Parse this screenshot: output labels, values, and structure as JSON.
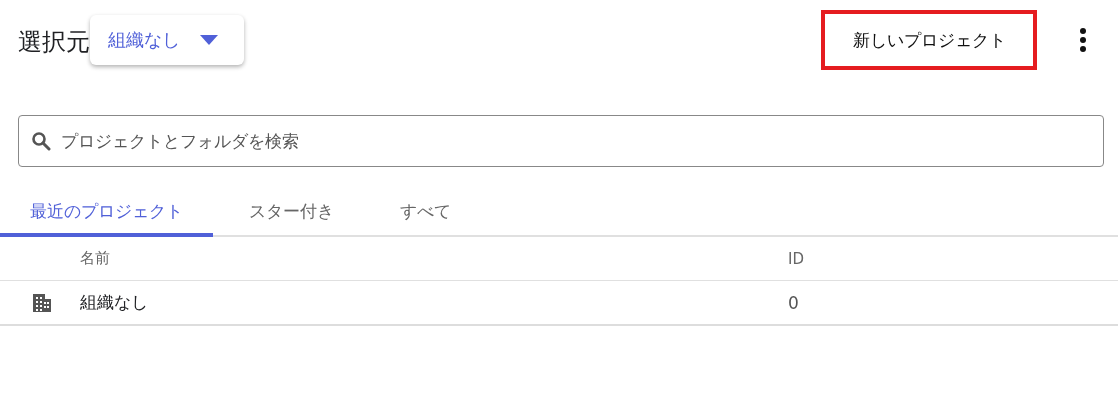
{
  "header": {
    "title": "選択元",
    "org_dropdown": {
      "value": "組織なし"
    },
    "new_project_button": {
      "label": "新しいプロジェクト",
      "highlighted": true
    }
  },
  "search": {
    "placeholder": "プロジェクトとフォルダを検索"
  },
  "tabs": [
    {
      "label": "最近のプロジェクト",
      "selected": true
    },
    {
      "label": "スター付き",
      "selected": false
    },
    {
      "label": "すべて",
      "selected": false
    }
  ],
  "table": {
    "columns": [
      "名前",
      "ID"
    ],
    "rows": [
      {
        "kind": "organization",
        "name": "組織なし",
        "id": "0"
      }
    ]
  }
}
